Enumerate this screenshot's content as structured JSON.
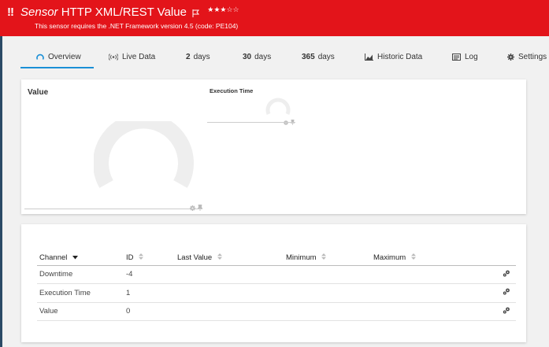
{
  "header": {
    "alert_mark": "!!",
    "sensor_type": "Sensor",
    "sensor_name": "HTTP XML/REST Value",
    "stars": "★★★☆☆",
    "flag_icon": "flag-icon",
    "message": "This sensor requires the .NET Framework version 4.5 (code: PE104)",
    "bg_color": "#e3141a"
  },
  "tabs": [
    {
      "icon": "overview-gauge-icon",
      "label": "Overview",
      "active": true
    },
    {
      "icon": "live-data-icon",
      "label": "Live Data"
    },
    {
      "num": "2",
      "label": "days"
    },
    {
      "num": "30",
      "label": "days"
    },
    {
      "num": "365",
      "label": "days"
    },
    {
      "icon": "historic-chart-icon",
      "label": "Historic Data"
    },
    {
      "icon": "log-icon",
      "label": "Log"
    },
    {
      "icon": "gear-icon",
      "label": "Settings"
    }
  ],
  "gauges": {
    "value": {
      "title": "Value",
      "icons": [
        "gear-icon",
        "pin-icon"
      ]
    },
    "execution_time": {
      "title": "Execution Time",
      "icons": [
        "gear-icon",
        "pin-icon"
      ]
    }
  },
  "table": {
    "headers": [
      "Channel",
      "ID",
      "Last Value",
      "Minimum",
      "Maximum"
    ],
    "rows": [
      {
        "channel": "Downtime",
        "id": "-4",
        "last_value": "",
        "minimum": "",
        "maximum": "",
        "action_icon": "channel-settings-icon"
      },
      {
        "channel": "Execution Time",
        "id": "1",
        "last_value": "",
        "minimum": "",
        "maximum": "",
        "action_icon": "channel-settings-icon"
      },
      {
        "channel": "Value",
        "id": "0",
        "last_value": "",
        "minimum": "",
        "maximum": "",
        "action_icon": "channel-settings-icon"
      }
    ]
  },
  "colors": {
    "accent": "#1a8fd6",
    "gauge": "#eeeeee"
  }
}
